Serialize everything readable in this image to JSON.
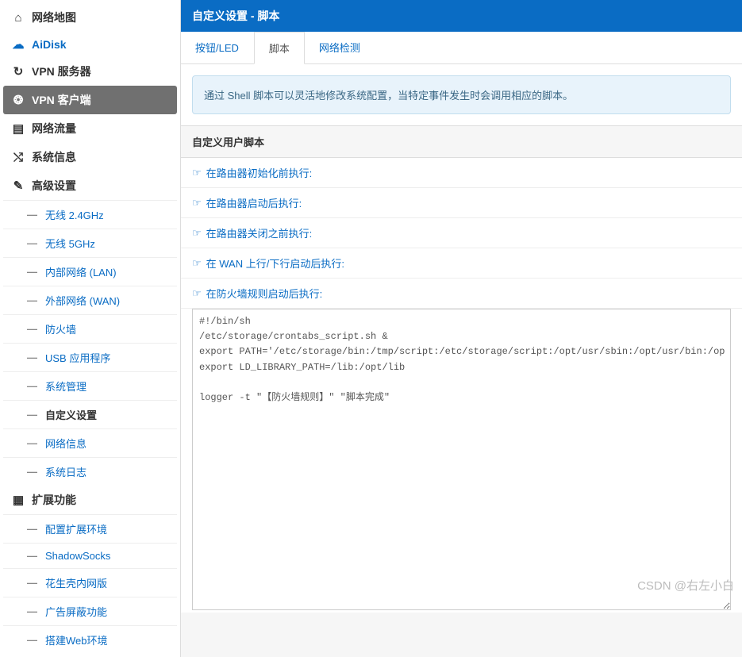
{
  "header": {
    "title": "自定义设置 - 脚本"
  },
  "tabs": {
    "t0": "按钮/LED",
    "t1": "脚本",
    "t2": "网络检测"
  },
  "info": {
    "text": "通过 Shell 脚本可以灵活地修改系统配置，当特定事件发生时会调用相应的脚本。"
  },
  "section_title": "自定义用户脚本",
  "scripts": {
    "r0": "在路由器初始化前执行:",
    "r1": "在路由器启动后执行:",
    "r2": "在路由器关闭之前执行:",
    "r3": "在 WAN 上行/下行启动后执行:",
    "r4": "在防火墙规则启动后执行:"
  },
  "code": "#!/bin/sh\n/etc/storage/crontabs_script.sh &\nexport PATH='/etc/storage/bin:/tmp/script:/etc/storage/script:/opt/usr/sbin:/opt/usr/bin:/op\nexport LD_LIBRARY_PATH=/lib:/opt/lib\n\nlogger -t \"【防火墙规则】\" \"脚本完成\"",
  "sidebar": {
    "items": {
      "i0": "网络地图",
      "i1": "AiDisk",
      "i2": "VPN 服务器",
      "i3": "VPN 客户端",
      "i4": "网络流量",
      "i5": "系统信息",
      "i6": "高级设置",
      "i7": "扩展功能"
    },
    "advanced": {
      "a0": "无线 2.4GHz",
      "a1": "无线 5GHz",
      "a2": "内部网络 (LAN)",
      "a3": "外部网络 (WAN)",
      "a4": "防火墙",
      "a5": "USB 应用程序",
      "a6": "系统管理",
      "a7": "自定义设置",
      "a8": "网络信息",
      "a9": "系统日志"
    },
    "ext": {
      "e0": "配置扩展环境",
      "e1": "ShadowSocks",
      "e2": "花生壳内网版",
      "e3": "广告屏蔽功能",
      "e4": "搭建Web环境"
    }
  },
  "watermark": "CSDN @右左小白"
}
